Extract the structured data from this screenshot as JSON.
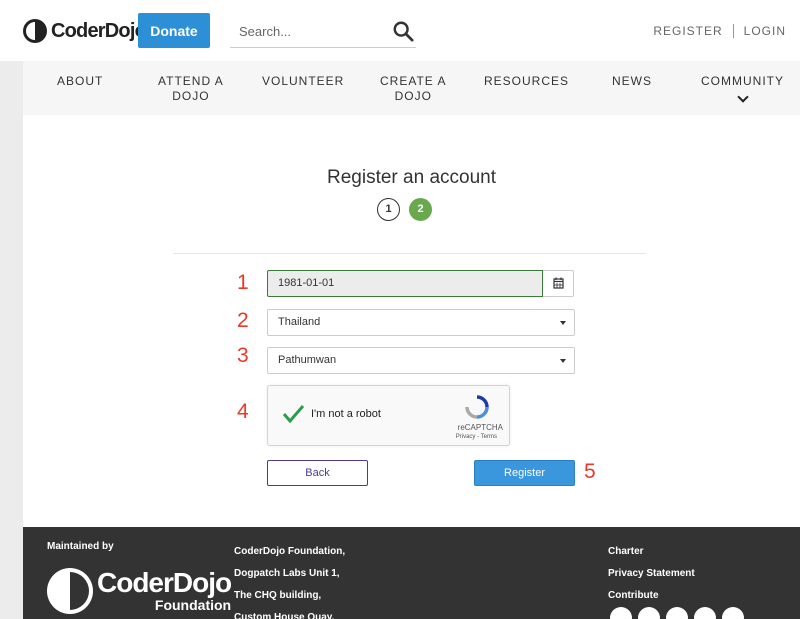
{
  "header": {
    "logo_text": "CoderDojo",
    "donate_label": "Donate",
    "search_placeholder": "Search...",
    "register_link": "REGISTER",
    "login_link": "LOGIN"
  },
  "nav": {
    "items": [
      {
        "label": "ABOUT"
      },
      {
        "label": "ATTEND A\nDOJO"
      },
      {
        "label": "VOLUNTEER"
      },
      {
        "label": "CREATE A\nDOJO"
      },
      {
        "label": "RESOURCES"
      },
      {
        "label": "NEWS"
      },
      {
        "label": "COMMUNITY"
      }
    ]
  },
  "form": {
    "title": "Register an account",
    "steps": [
      "1",
      "2"
    ],
    "active_step": 2,
    "annotations": [
      "1",
      "2",
      "3",
      "4",
      "5"
    ],
    "dob_value": "1981-01-01",
    "country_value": "Thailand",
    "city_value": "Pathumwan",
    "captcha_label": "I'm not a robot",
    "captcha_brand": "reCAPTCHA",
    "captcha_links": "Privacy - Terms",
    "captcha_checked": true,
    "back_label": "Back",
    "register_label": "Register"
  },
  "footer": {
    "maintained_by": "Maintained by",
    "logo_text": "CoderDojo",
    "logo_sub": "Foundation",
    "address_lines": [
      "CoderDojo Foundation,",
      "Dogpatch Labs Unit 1,",
      "The CHQ building,",
      "Custom House Quay,"
    ],
    "links": [
      "Charter",
      "Privacy Statement",
      "Contribute"
    ],
    "social_icons": [
      "twitter-icon",
      "facebook-icon",
      "google-plus-icon",
      "linkedin-icon",
      "email-icon"
    ]
  },
  "colors": {
    "brand_blue": "#2d8fd5",
    "step_active": "#6aa84f",
    "annotation_red": "#e83a2a",
    "footer_bg": "#333333"
  }
}
